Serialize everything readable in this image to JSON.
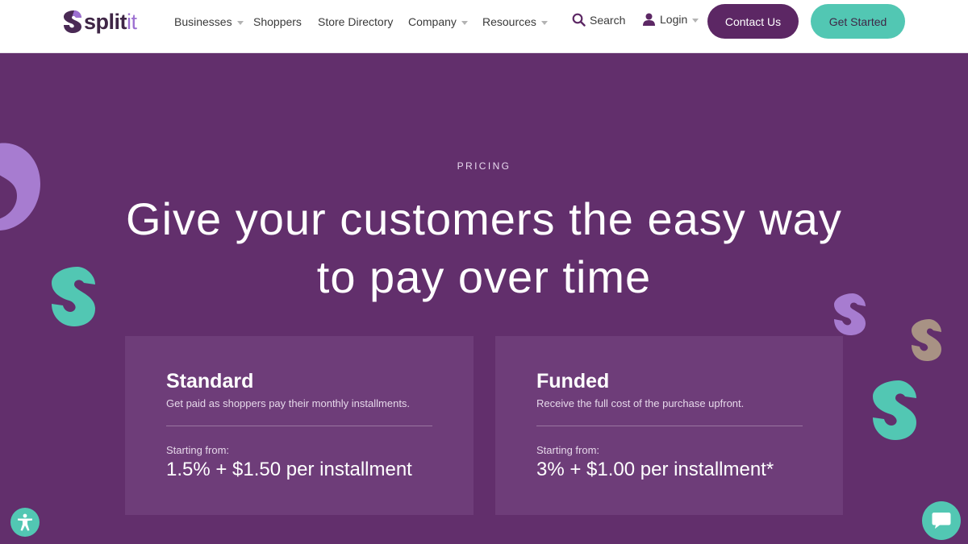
{
  "header": {
    "logo": {
      "brand": "splitit",
      "brand_main": "split",
      "brand_accent": "it"
    },
    "nav": [
      {
        "label": "Businesses",
        "dropdown": true
      },
      {
        "label": "Shoppers",
        "dropdown": false
      },
      {
        "label": "Store Directory",
        "dropdown": false
      },
      {
        "label": "Company",
        "dropdown": true
      },
      {
        "label": "Resources",
        "dropdown": true
      }
    ],
    "search_label": "Search",
    "login_label": "Login",
    "contact_label": "Contact Us",
    "get_started_label": "Get Started"
  },
  "hero": {
    "eyebrow": "PRICING",
    "title": "Give your customers the easy way to pay over time"
  },
  "cards": [
    {
      "title": "Standard",
      "description": "Get paid as shoppers pay their monthly installments.",
      "from_label": "Starting from:",
      "price": "1.5% + $1.50 per installment"
    },
    {
      "title": "Funded",
      "description": "Receive the full cost of the purchase upfront.",
      "from_label": "Starting from:",
      "price": "3% + $1.00 per installment*"
    }
  ],
  "icons": {
    "search": "search-icon",
    "login": "user-icon",
    "dropdown": "chevron-down-icon",
    "accessibility": "accessibility-icon",
    "chat": "chat-icon"
  },
  "colors": {
    "background": "#622f6c",
    "card": "#6e3d79",
    "primary_button": "#5c2764",
    "accent_teal": "#52c7b3",
    "accent_lavender": "#a77cd0",
    "accent_taupe": "#a89284",
    "header_bg": "#ffffff"
  }
}
